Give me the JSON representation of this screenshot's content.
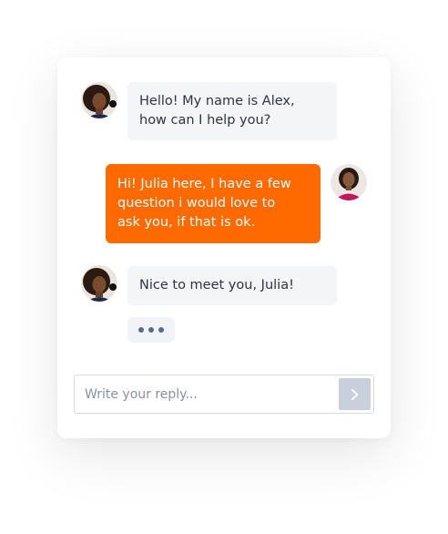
{
  "colors": {
    "accent": "#ff6a00",
    "bot_bubble": "#f4f5f7",
    "send_button": "#c9cfdb",
    "typing_dots": "#5c6b84"
  },
  "messages": [
    {
      "sender": "bot",
      "avatar": "alex-avatar",
      "line1": "Hello! My name is Alex,",
      "line2": "how can I help you?"
    },
    {
      "sender": "user",
      "avatar": "julia-avatar",
      "line1": "Hi! Julia here, I have a few",
      "line2": "question i would love to",
      "line3": "ask you, if that is ok."
    },
    {
      "sender": "bot",
      "avatar": "alex-avatar",
      "line1": "Nice to meet you, Julia!"
    }
  ],
  "typing_indicator": {
    "icon": "ellipsis-icon"
  },
  "reply": {
    "placeholder": "Write your reply...",
    "value": "",
    "send_icon": "chevron-right-icon"
  }
}
